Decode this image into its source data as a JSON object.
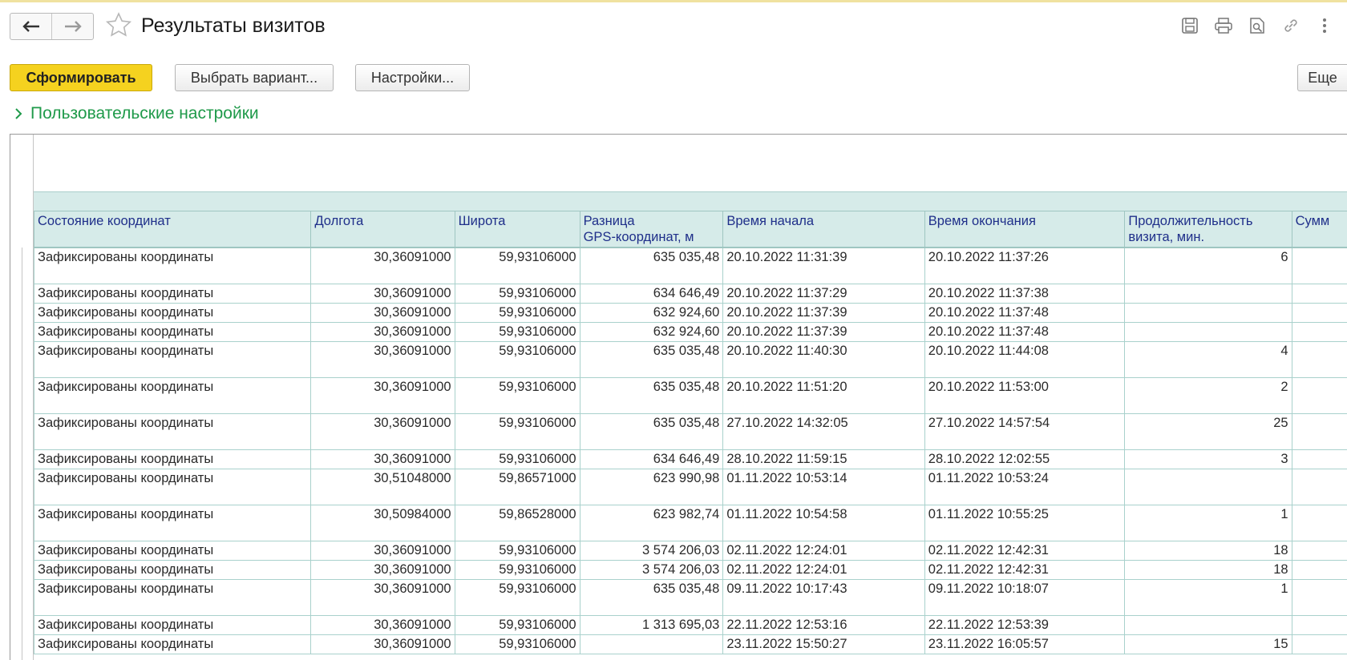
{
  "header": {
    "title": "Результаты визитов"
  },
  "commands": {
    "generate": "Сформировать",
    "choose_variant": "Выбрать вариант...",
    "settings": "Настройки...",
    "more": "Еще"
  },
  "user_settings": "Пользовательские настройки",
  "table": {
    "columns": [
      "Состояние координат",
      "Долгота",
      "Широта",
      "Разница\nGPS-координат, м",
      "Время начала",
      "Время окончания",
      "Продолжительность\nвизита, мин.",
      "Сумм"
    ],
    "rows": [
      {
        "state": "Зафиксированы координаты",
        "lon": "30,36091000",
        "lat": "59,93106000",
        "diff": "635 035,48",
        "start": "20.10.2022 11:31:39",
        "end": "20.10.2022 11:37:26",
        "dur": "6",
        "sum": ""
      },
      {
        "state": "Зафиксированы координаты",
        "lon": "30,36091000",
        "lat": "59,93106000",
        "diff": "634 646,49",
        "start": "20.10.2022 11:37:29",
        "end": "20.10.2022 11:37:38",
        "dur": "",
        "sum": ""
      },
      {
        "state": "Зафиксированы координаты",
        "lon": "30,36091000",
        "lat": "59,93106000",
        "diff": "632 924,60",
        "start": "20.10.2022 11:37:39",
        "end": "20.10.2022 11:37:48",
        "dur": "",
        "sum": ""
      },
      {
        "state": "Зафиксированы координаты",
        "lon": "30,36091000",
        "lat": "59,93106000",
        "diff": "632 924,60",
        "start": "20.10.2022 11:37:39",
        "end": "20.10.2022 11:37:48",
        "dur": "",
        "sum": ""
      },
      {
        "state": "Зафиксированы координаты",
        "lon": "30,36091000",
        "lat": "59,93106000",
        "diff": "635 035,48",
        "start": "20.10.2022 11:40:30",
        "end": "20.10.2022 11:44:08",
        "dur": "4",
        "sum": ""
      },
      {
        "state": "Зафиксированы координаты",
        "lon": "30,36091000",
        "lat": "59,93106000",
        "diff": "635 035,48",
        "start": "20.10.2022 11:51:20",
        "end": "20.10.2022 11:53:00",
        "dur": "2",
        "sum": ""
      },
      {
        "state": "Зафиксированы координаты",
        "lon": "30,36091000",
        "lat": "59,93106000",
        "diff": "635 035,48",
        "start": "27.10.2022 14:32:05",
        "end": "27.10.2022 14:57:54",
        "dur": "25",
        "sum": ""
      },
      {
        "state": "Зафиксированы координаты",
        "lon": "30,36091000",
        "lat": "59,93106000",
        "diff": "634 646,49",
        "start": "28.10.2022 11:59:15",
        "end": "28.10.2022 12:02:55",
        "dur": "3",
        "sum": ""
      },
      {
        "state": "Зафиксированы координаты",
        "lon": "30,51048000",
        "lat": "59,86571000",
        "diff": "623 990,98",
        "start": "01.11.2022 10:53:14",
        "end": "01.11.2022 10:53:24",
        "dur": "",
        "sum": ""
      },
      {
        "state": "Зафиксированы координаты",
        "lon": "30,50984000",
        "lat": "59,86528000",
        "diff": "623 982,74",
        "start": "01.11.2022 10:54:58",
        "end": "01.11.2022 10:55:25",
        "dur": "1",
        "sum": ""
      },
      {
        "state": "Зафиксированы координаты",
        "lon": "30,36091000",
        "lat": "59,93106000",
        "diff": "3 574 206,03",
        "start": "02.11.2022 12:24:01",
        "end": "02.11.2022 12:42:31",
        "dur": "18",
        "sum": ""
      },
      {
        "state": "Зафиксированы координаты",
        "lon": "30,36091000",
        "lat": "59,93106000",
        "diff": "3 574 206,03",
        "start": "02.11.2022 12:24:01",
        "end": "02.11.2022 12:42:31",
        "dur": "18",
        "sum": ""
      },
      {
        "state": "Зафиксированы координаты",
        "lon": "30,36091000",
        "lat": "59,93106000",
        "diff": "635 035,48",
        "start": "09.11.2022 10:17:43",
        "end": "09.11.2022 10:18:07",
        "dur": "1",
        "sum": ""
      },
      {
        "state": "Зафиксированы координаты",
        "lon": "30,36091000",
        "lat": "59,93106000",
        "diff": "1 313 695,03",
        "start": "22.11.2022 12:53:16",
        "end": "22.11.2022 12:53:39",
        "dur": "",
        "sum": ""
      },
      {
        "state": "Зафиксированы координаты",
        "lon": "30,36091000",
        "lat": "59,93106000",
        "diff": "",
        "start": "23.11.2022 15:50:27",
        "end": "23.11.2022 16:05:57",
        "dur": "15",
        "sum": ""
      }
    ]
  },
  "colors": {
    "primary_button": "#f5d21f",
    "header_fill": "#d6ebe9",
    "link_green": "#1f9a4a",
    "header_text": "#1f2f8a"
  }
}
